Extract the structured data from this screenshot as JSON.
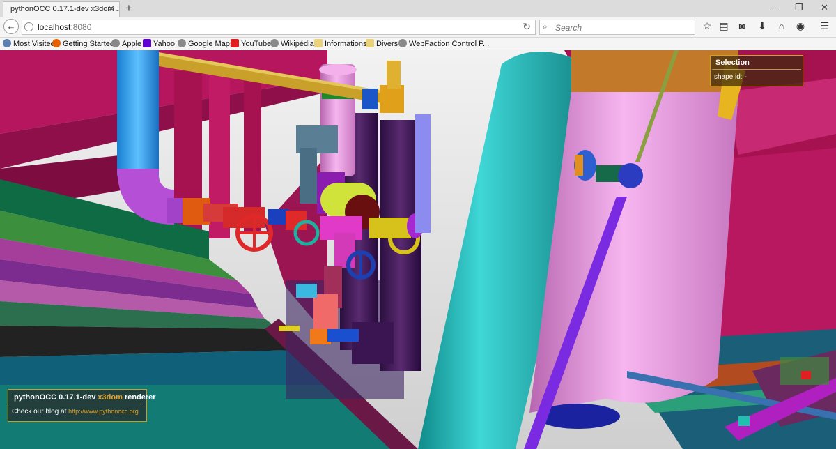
{
  "tab": {
    "title": "pythonOCC 0.17.1-dev x3dom ...",
    "close": "✕",
    "new": "+"
  },
  "window": {
    "minimize": "—",
    "restore": "❐",
    "close": "✕"
  },
  "nav": {
    "url_host": "localhost",
    "url_port": ":8080",
    "search_placeholder": "Search"
  },
  "bookmarks": [
    {
      "label": "Most Visited",
      "icon": "gear-icon",
      "color": "#5a7fb0"
    },
    {
      "label": "Getting Started",
      "icon": "firefox-icon",
      "color": "#e66000"
    },
    {
      "label": "Apple",
      "icon": "globe-icon",
      "color": "#8a8a8a"
    },
    {
      "label": "Yahoo!",
      "icon": "yahoo-icon",
      "color": "#5f01d1"
    },
    {
      "label": "Google Maps",
      "icon": "globe-icon",
      "color": "#8a8a8a"
    },
    {
      "label": "YouTube",
      "icon": "youtube-icon",
      "color": "#e02020"
    },
    {
      "label": "Wikipédia",
      "icon": "globe-icon",
      "color": "#8a8a8a"
    },
    {
      "label": "Informations",
      "icon": "folder-icon",
      "color": "#e9d27a"
    },
    {
      "label": "Divers",
      "icon": "folder-icon",
      "color": "#e9d27a"
    },
    {
      "label": "WebFaction Control P...",
      "icon": "globe-icon",
      "color": "#8a8a8a"
    }
  ],
  "selection_panel": {
    "title": "Selection",
    "label": "shape id:",
    "value": "-"
  },
  "info_panel": {
    "title_prefix": "pythonOCC 0.17.1-dev ",
    "title_accent": "x3dom",
    "title_suffix": " renderer",
    "blog_text": "Check our blog at ",
    "blog_link": "http://www.pythonocc.org"
  },
  "colors": {
    "accent": "#e8a020",
    "magenta_frame": "#b5165e",
    "teal_tank": "#22b9b9",
    "pink_tank": "#f19ee8"
  }
}
